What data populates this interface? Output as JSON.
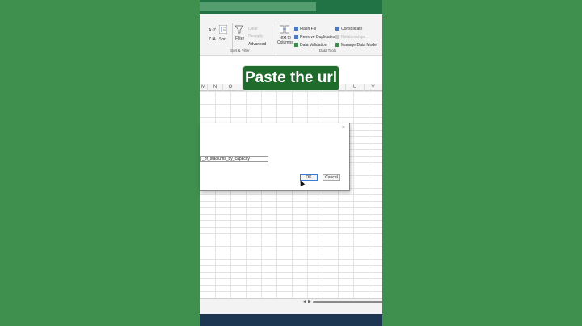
{
  "ribbon": {
    "sort_az": "A↓Z",
    "sort_za": "Z↓A",
    "sort": "Sort",
    "filter": "Filter",
    "clear": "Clear",
    "reapply": "Reapply",
    "advanced": "Advanced",
    "text_to_columns_1": "Text to",
    "text_to_columns_2": "Columns",
    "flash_fill": "Flash Fill",
    "remove_duplicates": "Remove Duplicates",
    "data_validation": "Data Validation",
    "consolidate": "Consolidate",
    "relationships": "Relationships",
    "manage_data_model": "Manage Data Model",
    "group_sort_filter": "Sort & Filter",
    "group_data_tools": "Data Tools"
  },
  "columns": [
    "M",
    "N",
    "O",
    "P",
    "Q",
    "R",
    "S",
    "T",
    "U",
    "V"
  ],
  "callout": "Paste the url",
  "dialog": {
    "close": "×",
    "url_value": "_of_stadiums_by_capacity",
    "ok": "OK",
    "cancel": "Cancel"
  },
  "colors": {
    "background": "#3f8f4f",
    "callout_bg": "#1f6b2c",
    "excel_green": "#217346"
  }
}
